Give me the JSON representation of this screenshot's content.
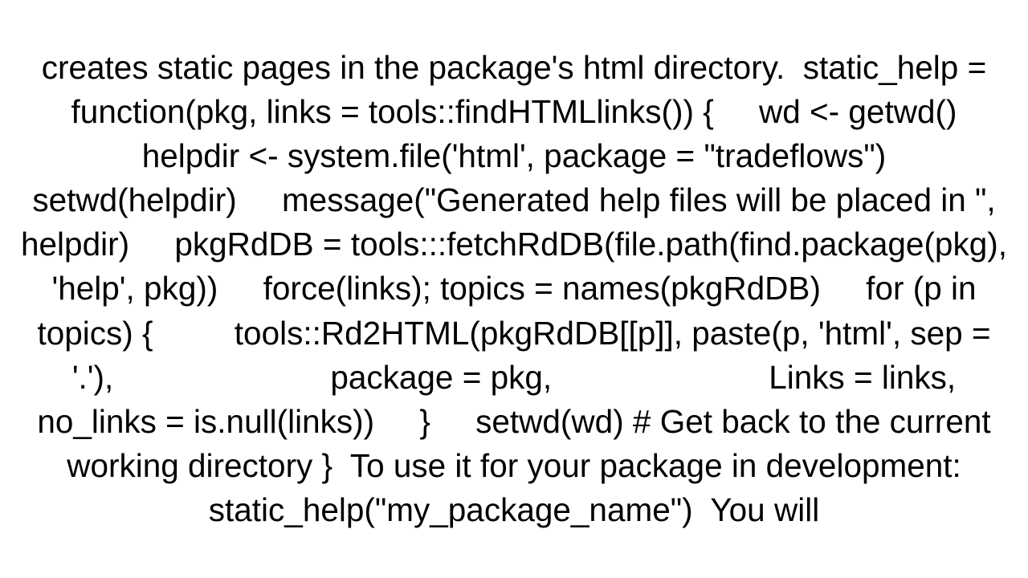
{
  "body": "creates static pages in the package's html directory.  static_help = function(pkg, links = tools::findHTMLlinks()) {     wd <- getwd()     helpdir <- system.file('html', package = \"tradeflows\")     setwd(helpdir)     message(\"Generated help files will be placed in \", helpdir)     pkgRdDB = tools:::fetchRdDB(file.path(find.package(pkg), 'help', pkg))     force(links); topics = names(pkgRdDB)     for (p in topics) {         tools::Rd2HTML(pkgRdDB[[p]], paste(p, 'html', sep = '.'),                        package = pkg,                        Links = links,                        no_links = is.null(links))     }     setwd(wd) # Get back to the current working directory }  To use it for your package in development: static_help(\"my_package_name\")  You will"
}
